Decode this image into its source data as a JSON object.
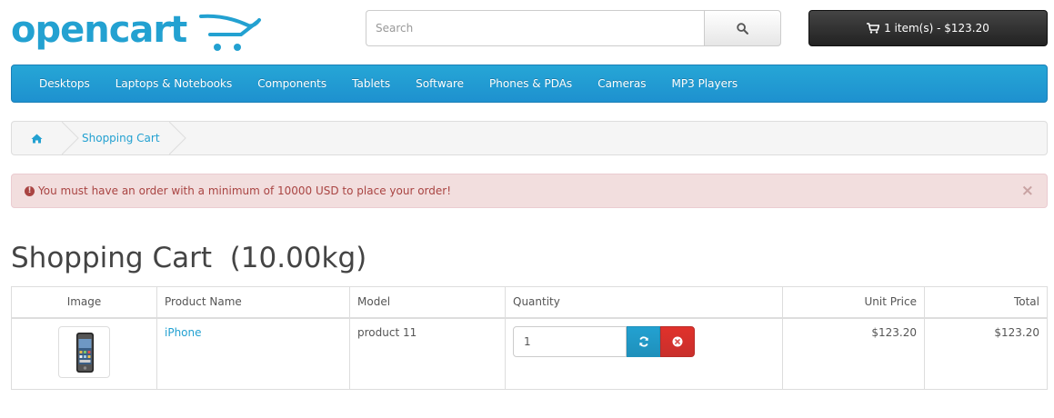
{
  "header": {
    "logo_text": "opencart",
    "search_placeholder": "Search",
    "search_value": "",
    "cart_label": "1 item(s) - $123.20"
  },
  "menu": {
    "items": [
      {
        "label": "Desktops"
      },
      {
        "label": "Laptops & Notebooks"
      },
      {
        "label": "Components"
      },
      {
        "label": "Tablets"
      },
      {
        "label": "Software"
      },
      {
        "label": "Phones & PDAs"
      },
      {
        "label": "Cameras"
      },
      {
        "label": "MP3 Players"
      }
    ]
  },
  "breadcrumb": {
    "current": "Shopping Cart"
  },
  "alert": {
    "message": "You must have an order with a minimum of 10000 USD to place your order!",
    "close": "×"
  },
  "page_title": "Shopping Cart  (10.00kg)",
  "cart_table": {
    "headers": {
      "image": "Image",
      "name": "Product Name",
      "model": "Model",
      "quantity": "Quantity",
      "unit_price": "Unit Price",
      "total": "Total"
    },
    "rows": [
      {
        "name": "iPhone",
        "model": "product 11",
        "quantity": "1",
        "unit_price": "$123.20",
        "total": "$123.20"
      }
    ]
  },
  "colors": {
    "brand_blue": "#23a1d1",
    "menu_blue": "#229ac8",
    "alert_bg": "#f2dede",
    "alert_text": "#a94442",
    "remove_red": "#d9534f",
    "cart_dark": "#363636"
  },
  "icons": {
    "search": "search-icon",
    "cart": "shopping-cart-icon",
    "home": "home-icon",
    "alert": "exclamation-circle-icon",
    "update": "refresh-icon",
    "remove": "times-circle-icon"
  }
}
